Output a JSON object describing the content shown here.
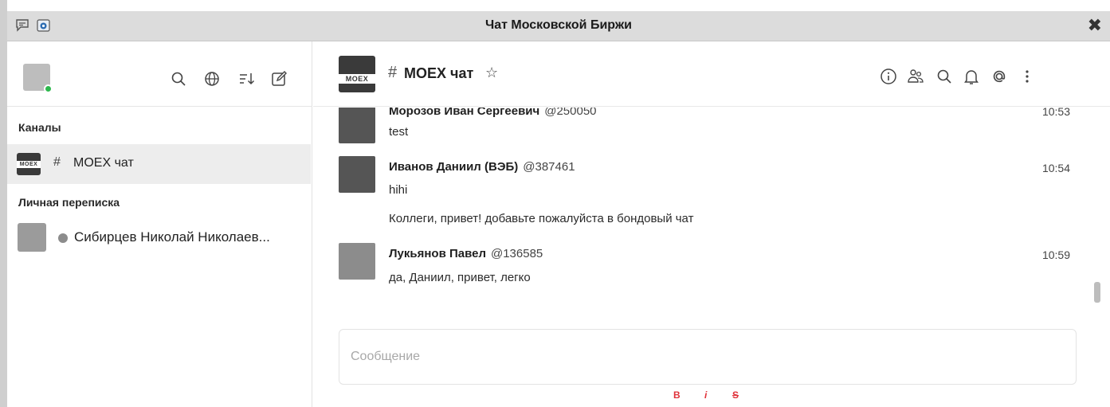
{
  "window": {
    "title": "Чат Московской Биржи",
    "close_label": "✖"
  },
  "sidebar": {
    "channels_label": "Каналы",
    "channel_name": "MOEX чат",
    "channel_hash": "#",
    "dm_label": "Личная переписка",
    "dm_contact": "Сибирцев Николай Николаев..."
  },
  "channel": {
    "logo_text": "MOEX",
    "hash": "#",
    "title": "MOEX чат",
    "star": "☆"
  },
  "messages": [
    {
      "author": "Морозов Иван Сергеевич",
      "handle": "@250050",
      "time": "10:53",
      "text": "test"
    },
    {
      "author": "Иванов Даниил (ВЭБ)",
      "handle": "@387461",
      "time": "10:54",
      "text": "hihi",
      "followup": "Коллеги, привет! добавьте пожалуйста в бондовый чат"
    },
    {
      "author": "Лукьянов Павел",
      "handle": "@136585",
      "time": "10:59",
      "text": "да, Даниил, привет, легко"
    }
  ],
  "composer": {
    "placeholder": "Сообщение",
    "bold": "B",
    "italic": "i",
    "strike": "S"
  },
  "colors": {
    "accent_format": "#e0323a",
    "online": "#2db84d",
    "selected_row": "#ededed"
  }
}
